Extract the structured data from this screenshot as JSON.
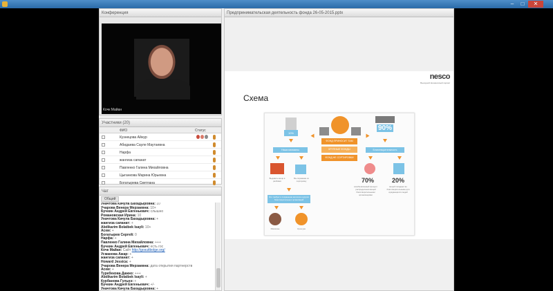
{
  "window": {},
  "conference": {
    "header": "Конференция",
    "video_caption": "Кочк Майан"
  },
  "participants": {
    "header": "Участники (20)",
    "col_fio": "ФИО",
    "col_status": "Статус",
    "rows": [
      {
        "name": "Кузнецова Айнур"
      },
      {
        "name": "Абидаева Сауле Маутаевна"
      },
      {
        "name": "Нарфа"
      },
      {
        "name": "жангиза сапанат"
      },
      {
        "name": "Павленко Галина Михайловна"
      },
      {
        "name": "Цыганкова Марина Юрьевна"
      },
      {
        "name": "Богатырева Светлана"
      }
    ]
  },
  "chat": {
    "header": "Чат",
    "tab": "Общий",
    "lines": [
      {
        "author": "Уначтова Качула Бахадыровна:",
        "msg": "10"
      },
      {
        "author": "Учарова Венера Мерзаевна:",
        "msg": "10+"
      },
      {
        "author": "Бучкин Андрей Евгеньевич:",
        "msg": "слышно"
      },
      {
        "author": "Романовская Ирина:",
        "msg": "10"
      },
      {
        "author": "Уначтова Качула Бахадыровна:",
        "msg": "+"
      },
      {
        "author": "жангиза сапанат:",
        "msg": "+"
      },
      {
        "author": "Abdikarim Bolatbek Isayli:",
        "msg": "10+"
      },
      {
        "author": "Асем:",
        "msg": "+"
      },
      {
        "author": "Богатырев Сергей:",
        "msg": "0"
      },
      {
        "author": "Нарфа:",
        "msg": "+"
      },
      {
        "author": "Павленко Галина Михайловна:",
        "msg": "+++"
      },
      {
        "author": "Бучкин Андрей Евгеньевич:",
        "msg": "есть гос"
      },
      {
        "author": "Кочк Майан:",
        "msg": "Сайт",
        "link": "http://gosuitbolge.org/"
      },
      {
        "author": "Усманова Ажар:",
        "msg": "+"
      },
      {
        "author": "жангиза сапанат:",
        "msg": "+"
      },
      {
        "author": "Howard Jessica:",
        "msg": "+"
      },
      {
        "author": "Учарова Венера Мерзаевна:",
        "msg": "дата открытия партнерств"
      },
      {
        "author": "Асем:",
        "msg": "+"
      },
      {
        "author": "Туребекова Дажно:",
        "msg": "+++"
      },
      {
        "author": "Abdikarim Bolatbek Isayli:",
        "msg": "+"
      },
      {
        "author": "Курбанова Гульнэ:",
        "msg": "+"
      },
      {
        "author": "Бучкин Андрей Евгеньевич:",
        "msg": "+/-"
      },
      {
        "author": "Уначтова Качула Бахадыровна:",
        "msg": "+"
      },
      {
        "author": "Нечурковская Вера:",
        "msg": "+"
      },
      {
        "author": "Учарова Венера Мерзаевна:",
        "msg": "+"
      }
    ]
  },
  "presentation": {
    "header": "Предпринимательская деятельность фонда 26-05-2015.pptx",
    "logo": "nesco",
    "logo_sub": "Выездной финансовый сервис",
    "slide_title": "Схема",
    "center_labels": [
      "ФОНД ПРИНОСИТ ТАМ",
      "КРУПНЫЕ ФОНДЫ",
      "ФОНД НЕ СОРТИРОВКИ"
    ],
    "left_top_pct": "10%",
    "left_box": "Наши магазины",
    "right_top_pct": "90%",
    "right_box": "Благотворительность",
    "pct_70": "70%",
    "pct_20": "20%",
    "cap_70": "возобновляемый процент распределения вещей благотворительными организациями",
    "cap_20": "вещей попадают во благотворительными для нуждающихся людей",
    "left_cap1": "Выдавать вещи в разбивки",
    "left_cap2": "Мы поражаем их сортировку",
    "mid_blue": "Это требует и сохранение экологии и других благотворительных организаций",
    "bottom_cap1": "Магазины",
    "bottom_cap2": "Культура"
  },
  "colors": {
    "accent_orange": "#f0932a",
    "accent_blue": "#7cc3e6",
    "accent_pink": "#ef8c8c"
  }
}
